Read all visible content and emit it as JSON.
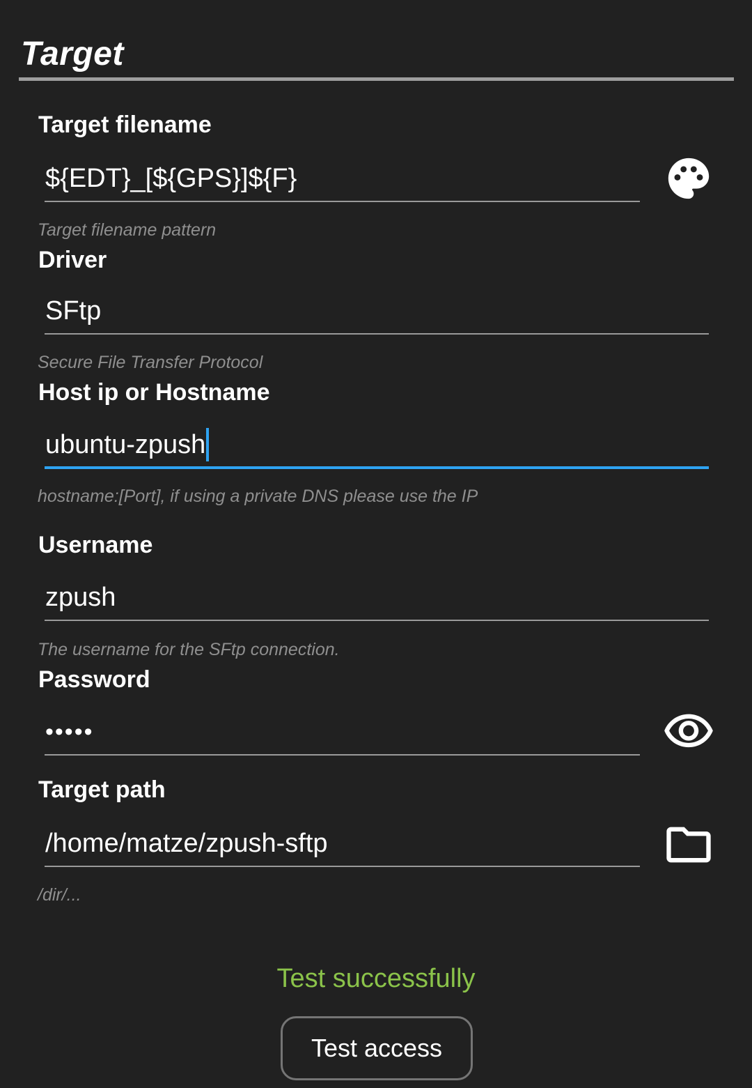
{
  "section": {
    "title": "Target"
  },
  "fields": {
    "target_filename": {
      "label": "Target filename",
      "value": "${EDT}_[${GPS}]${F}",
      "hint": "Target filename pattern",
      "action_icon": "palette-icon"
    },
    "driver": {
      "label": "Driver",
      "value": "SFtp",
      "hint": "Secure File Transfer Protocol"
    },
    "host": {
      "label": "Host ip or Hostname",
      "value": "ubuntu-zpush",
      "hint": "hostname:[Port], if using a private DNS please use the IP",
      "focused": true
    },
    "username": {
      "label": "Username",
      "value": "zpush",
      "hint": "The username for the SFtp connection."
    },
    "password": {
      "label": "Password",
      "value": "•••••",
      "action_icon": "eye-icon"
    },
    "target_path": {
      "label": "Target path",
      "value": "/home/matze/zpush-sftp",
      "hint": "/dir/...",
      "action_icon": "folder-icon"
    }
  },
  "status": {
    "text": "Test successfully",
    "color": "#8bc34a"
  },
  "test_button": {
    "label": "Test access"
  },
  "colors": {
    "background": "#212121",
    "accent": "#2ea3f2",
    "divider": "#9e9e9e"
  }
}
